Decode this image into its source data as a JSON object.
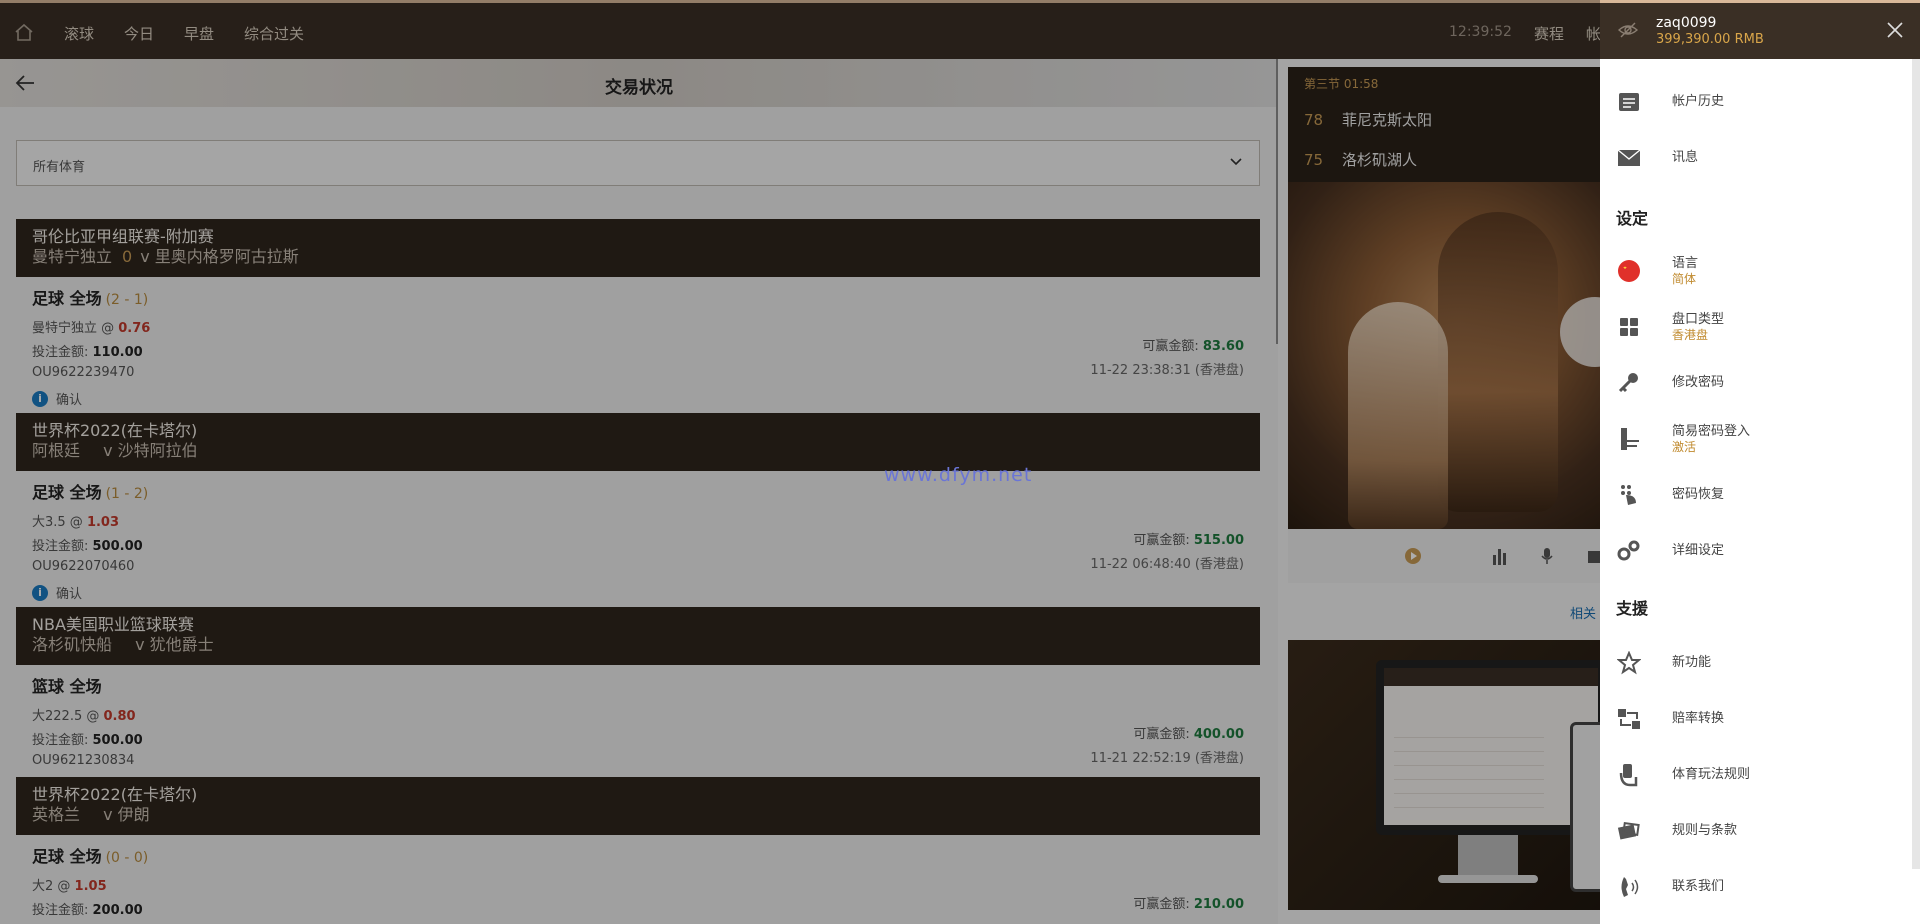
{
  "topbar": {
    "nav": [
      "滚球",
      "今日",
      "早盘",
      "综合过关"
    ],
    "clock": "12:39:52",
    "right_links": [
      "赛程",
      "帐"
    ]
  },
  "page": {
    "title": "交易状况",
    "sport_filter": "所有体育"
  },
  "bets": [
    {
      "league": "哥伦比亚甲组联赛-附加赛",
      "home": "曼特宁独立",
      "score": "0",
      "vs": "v",
      "away": "里奥内格罗阿古拉斯",
      "market": "足球 全场",
      "market_score": "(2 - 1)",
      "selection": "曼特宁独立 @ ",
      "odds": "0.76",
      "stake_label": "投注金额: ",
      "stake": "110.00",
      "win_label": "可赢金额: ",
      "win": "83.60",
      "ref": "OU9622239470",
      "time": "11-22 23:38:31 (香港盘)",
      "status": "确认"
    },
    {
      "league": "世界杯2022(在卡塔尔)",
      "home": "阿根廷",
      "score": "",
      "vs": "v",
      "away": "沙特阿拉伯",
      "market": "足球 全场",
      "market_score": "(1 - 2)",
      "selection": "大3.5 @ ",
      "odds": "1.03",
      "stake_label": "投注金额: ",
      "stake": "500.00",
      "win_label": "可赢金额: ",
      "win": "515.00",
      "ref": "OU9622070460",
      "time": "11-22 06:48:40 (香港盘)",
      "status": "确认"
    },
    {
      "league": "NBA美国职业篮球联赛",
      "home": "洛杉矶快船",
      "score": "",
      "vs": "v",
      "away": "犹他爵士",
      "market": "篮球 全场",
      "market_score": "",
      "selection": "大222.5 @ ",
      "odds": "0.80",
      "stake_label": "投注金额: ",
      "stake": "500.00",
      "win_label": "可赢金额: ",
      "win": "400.00",
      "ref": "OU9621230834",
      "time": "11-21 22:52:19 (香港盘)",
      "status": ""
    },
    {
      "league": "世界杯2022(在卡塔尔)",
      "home": "英格兰",
      "score": "",
      "vs": "v",
      "away": "伊朗",
      "market": "足球 全场",
      "market_score": "(0 - 0)",
      "selection": "大2 @ ",
      "odds": "1.05",
      "stake_label": "投注金额: ",
      "stake": "200.00",
      "win_label": "可赢金额: ",
      "win": "210.00",
      "ref": "",
      "time": "",
      "status": ""
    }
  ],
  "live": {
    "period": "第三节 01:58",
    "home_score": "78",
    "home": "菲尼克斯太阳",
    "away_score": "75",
    "away": "洛杉矶湖人",
    "related": "相关"
  },
  "watermark": "www.dfym.net",
  "account": {
    "user": "zaq0099",
    "balance": "399,390.00  RMB"
  },
  "menu": {
    "history": "帐户历史",
    "messages": "讯息",
    "settings_title": "设定",
    "language": "语言",
    "language_value": "简体",
    "odds_type": "盘口类型",
    "odds_type_value": "香港盘",
    "change_password": "修改密码",
    "easy_login": "简易密码登入",
    "easy_login_value": "激活",
    "password_recovery": "密码恢复",
    "detail_settings": "详细设定",
    "support_title": "支援",
    "new_features": "新功能",
    "odds_converter": "赔率转换",
    "sports_rules": "体育玩法规则",
    "terms": "规则与条款",
    "contact": "联系我们"
  },
  "colors": {
    "header": "#3a2f25",
    "league_band": "#2f261d",
    "accent_gold": "#c69a55",
    "odds_red": "#c0392b",
    "win_green": "#1e7a3e"
  }
}
